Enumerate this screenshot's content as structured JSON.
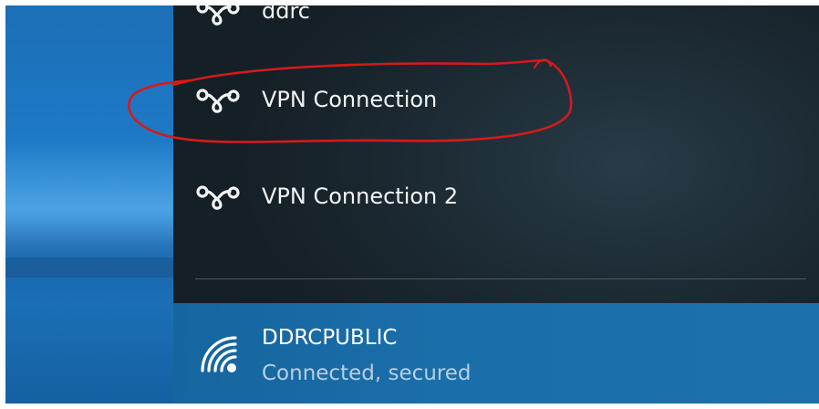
{
  "vpn_connections": [
    {
      "label": "ddrc"
    },
    {
      "label": "VPN Connection"
    },
    {
      "label": "VPN Connection 2"
    }
  ],
  "wifi": {
    "name": "DDRCPUBLIC",
    "status": "Connected, secured"
  },
  "colors": {
    "annotation": "#d61a1a",
    "flyout_bg": "#1c2a33",
    "wifi_selected_bg": "#1a6ea9"
  },
  "icons": {
    "vpn": "vpn-link-icon",
    "wifi": "wifi-signal-icon"
  }
}
